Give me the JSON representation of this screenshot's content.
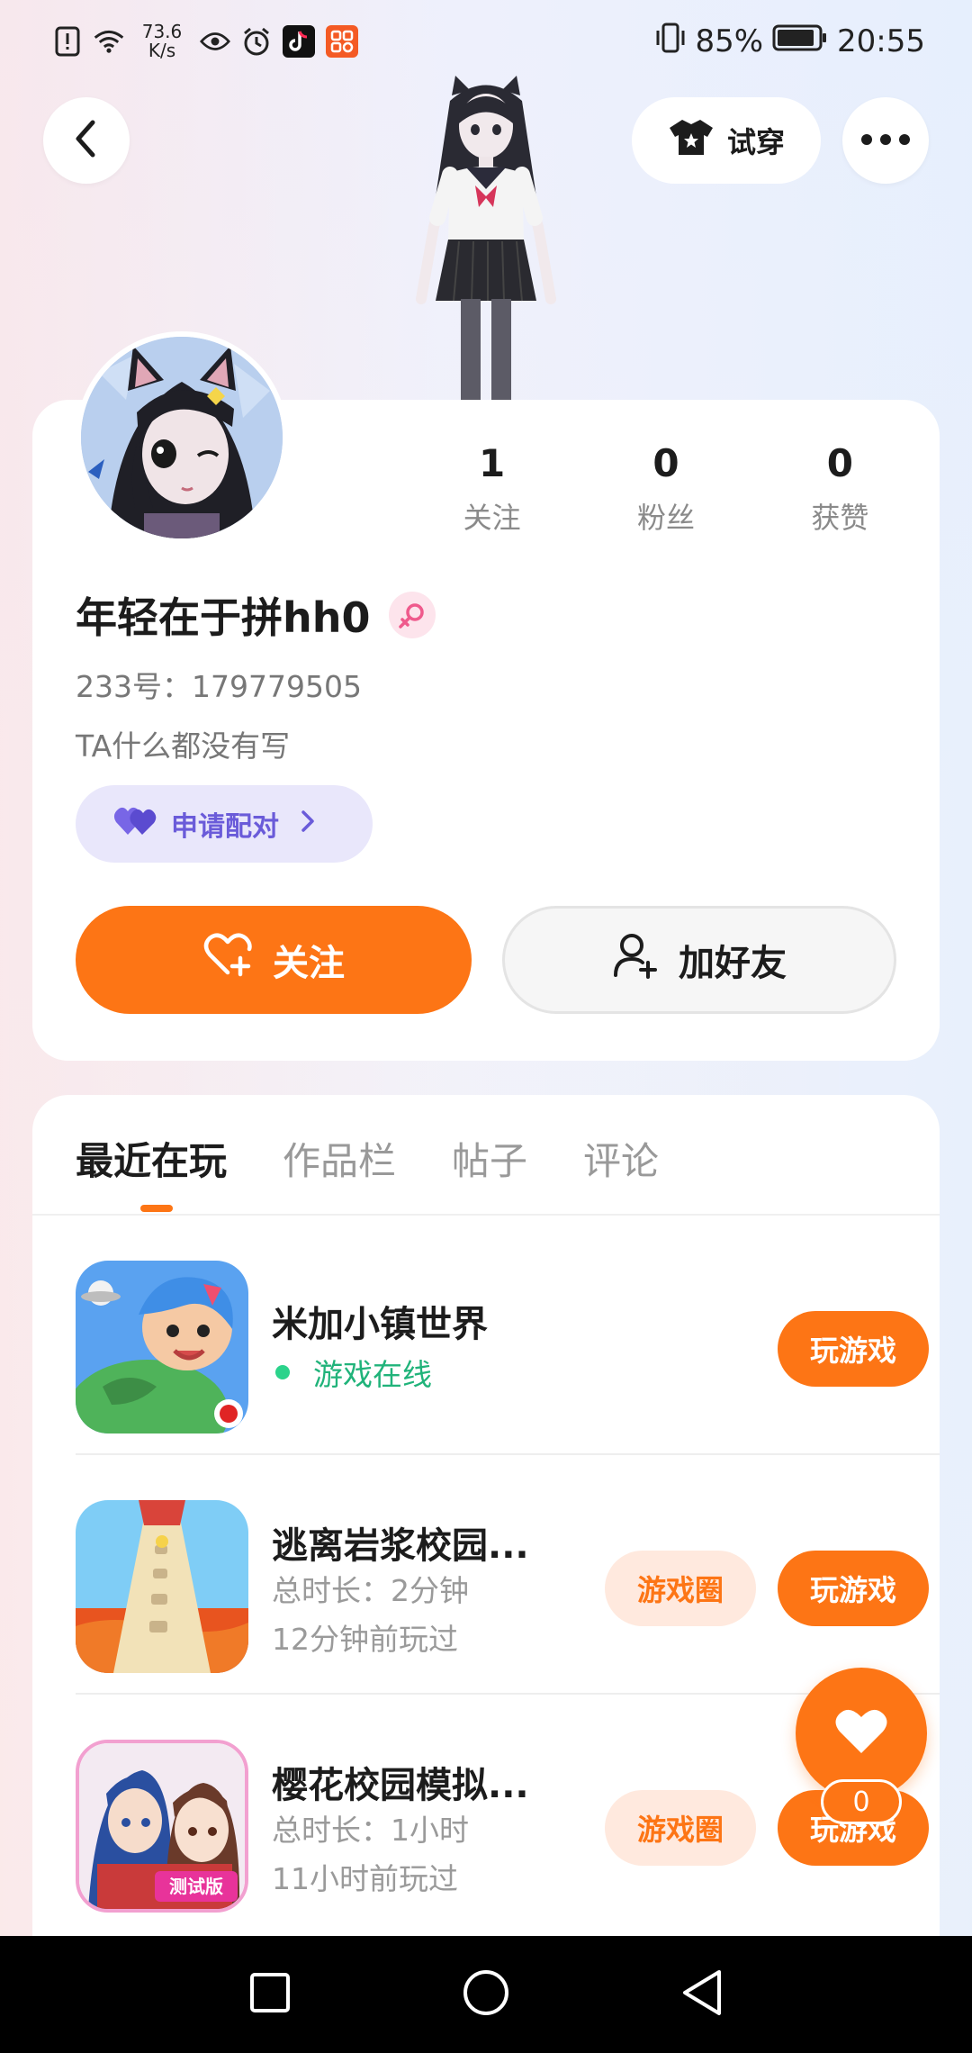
{
  "status_bar": {
    "net_speed": "73.6\nK/s",
    "battery": "85%",
    "time": "20:55"
  },
  "top_nav": {
    "back_icon": "back-arrow-icon",
    "tryon_label": "试穿",
    "more_icon": "more-dots-icon"
  },
  "profile": {
    "stats": [
      {
        "value": "1",
        "label": "关注"
      },
      {
        "value": "0",
        "label": "粉丝"
      },
      {
        "value": "0",
        "label": "获赞"
      }
    ],
    "username": "年轻在于拼hh0",
    "gender_icon": "female-icon",
    "uid": "233号：179779505",
    "bio": "TA什么都没有写",
    "match_label": "申请配对",
    "follow_label": "关注",
    "add_friend_label": "加好友"
  },
  "tabs": [
    "最近在玩",
    "作品栏",
    "帖子",
    "评论"
  ],
  "games": [
    {
      "name": "米加小镇世界",
      "status": "游戏在线",
      "play": "玩游戏"
    },
    {
      "name": "逃离岩浆校园...",
      "duration": "总时长：2分钟",
      "last_played": "12分钟前玩过",
      "circle": "游戏圈",
      "play": "玩游戏"
    },
    {
      "name": "樱花校园模拟...",
      "duration": "总时长：1小时",
      "last_played": "11小时前玩过",
      "circle": "游戏圈",
      "play": "玩游戏"
    }
  ],
  "fab": {
    "count": "0"
  },
  "colors": {
    "accent": "#fd7515",
    "match": "#6a5bd9",
    "online": "#20b37a"
  }
}
